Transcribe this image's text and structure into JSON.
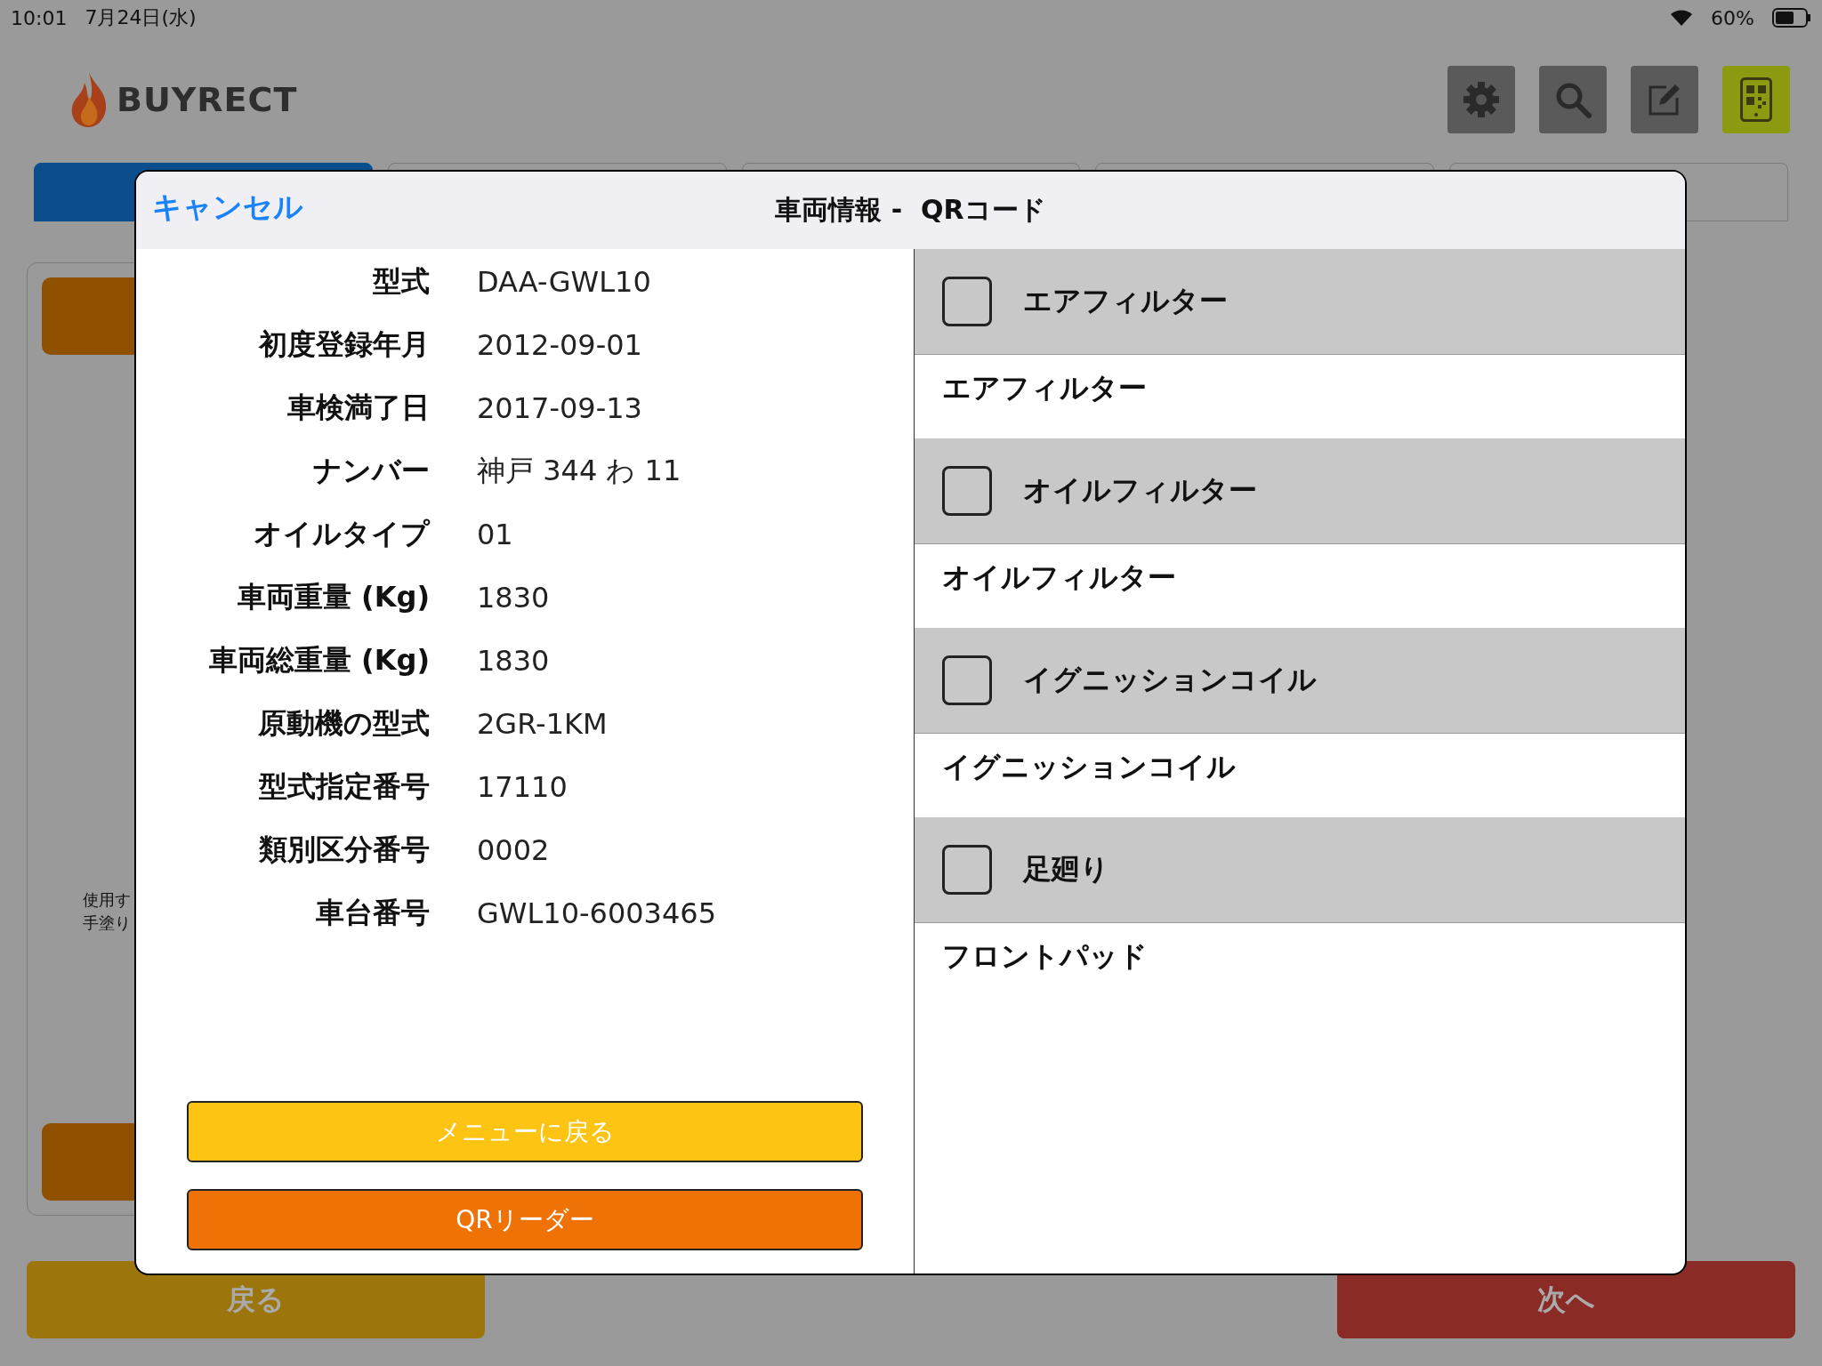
{
  "status_bar": {
    "time": "10:01",
    "date": "7月24日(水)",
    "battery": "60%"
  },
  "header": {
    "logo": "BUYRECT",
    "toolbar": [
      {
        "kind": "settings",
        "selected": false
      },
      {
        "kind": "search",
        "selected": false
      },
      {
        "kind": "edit",
        "selected": false
      },
      {
        "kind": "qr",
        "selected": true
      }
    ]
  },
  "tabs": [
    {
      "selected": true
    },
    {
      "selected": false
    },
    {
      "selected": false
    },
    {
      "selected": false
    },
    {
      "selected": false
    }
  ],
  "background_panel": {
    "note_lines": [
      "使用す",
      "手塗り"
    ]
  },
  "footer_buttons": [
    {
      "kind": "back",
      "label": "戻る"
    },
    {
      "kind": "next",
      "label": "次へ"
    }
  ],
  "dialog": {
    "cancel": "キャンセル",
    "title": "車両情報 -  QRコード",
    "fields": [
      {
        "label": "型式",
        "value": "DAA-GWL10"
      },
      {
        "label": "初度登録年月",
        "value": "2012-09-01"
      },
      {
        "label": "車検満了日",
        "value": "2017-09-13"
      },
      {
        "label": "ナンバー",
        "value": "神戸 344 わ 11"
      },
      {
        "label": "オイルタイプ",
        "value": "01"
      },
      {
        "label": "車両重量 (Kg)",
        "value": "1830"
      },
      {
        "label": "車両総重量 (Kg)",
        "value": "1830"
      },
      {
        "label": "原動機の型式",
        "value": "2GR-1KM"
      },
      {
        "label": "型式指定番号",
        "value": "17110"
      },
      {
        "label": "類別区分番号",
        "value": "0002"
      },
      {
        "label": "車台番号",
        "value": "GWL10-6003465"
      }
    ],
    "buttons": [
      {
        "kind": "menu",
        "label": "メニューに戻る"
      },
      {
        "kind": "reader",
        "label": "QRリーダー"
      }
    ],
    "checklist": [
      {
        "title": "エアフィルター",
        "checked": false,
        "detail": "エアフィルター"
      },
      {
        "title": "オイルフィルター",
        "checked": false,
        "detail": "オイルフィルター"
      },
      {
        "title": "イグニッションコイル",
        "checked": false,
        "detail": "イグニッションコイル"
      },
      {
        "title": "足廻り",
        "checked": false,
        "detail": "フロントパッド"
      }
    ]
  }
}
